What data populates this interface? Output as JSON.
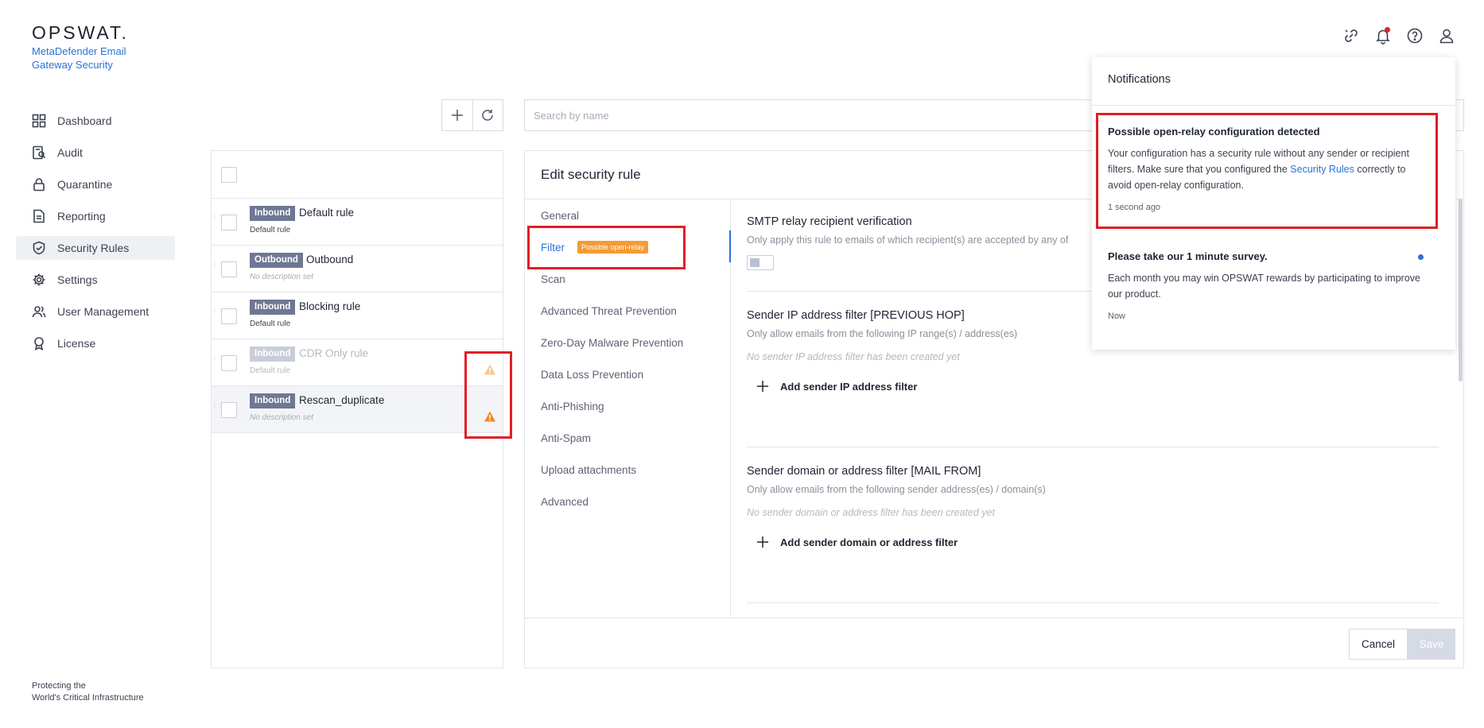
{
  "brand": {
    "logo": "OPSWAT.",
    "product": "MetaDefender Email Gateway Security",
    "tagline_line1": "Protecting the",
    "tagline_line2": "World's Critical Infrastructure"
  },
  "sidebar": {
    "items": [
      {
        "label": "Dashboard",
        "icon": "grid-icon"
      },
      {
        "label": "Audit",
        "icon": "audit-icon"
      },
      {
        "label": "Quarantine",
        "icon": "lock-icon"
      },
      {
        "label": "Reporting",
        "icon": "document-icon"
      },
      {
        "label": "Security Rules",
        "icon": "shield-check-icon",
        "active": true
      },
      {
        "label": "Settings",
        "icon": "gear-icon"
      },
      {
        "label": "User Management",
        "icon": "users-icon"
      },
      {
        "label": "License",
        "icon": "award-icon"
      }
    ]
  },
  "search": {
    "placeholder": "Search by name"
  },
  "rules": [
    {
      "direction": "Inbound",
      "name": "Default rule",
      "desc": "Default rule",
      "desc_italic": false,
      "warning": false,
      "disabled": false
    },
    {
      "direction": "Outbound",
      "name": "Outbound",
      "desc": "No description set",
      "desc_italic": true,
      "warning": false,
      "disabled": false
    },
    {
      "direction": "Inbound",
      "name": "Blocking rule",
      "desc": "Default rule",
      "desc_italic": false,
      "warning": false,
      "disabled": false
    },
    {
      "direction": "Inbound",
      "name": "CDR Only rule",
      "desc": "Default rule",
      "desc_italic": false,
      "warning": true,
      "disabled": true
    },
    {
      "direction": "Inbound",
      "name": "Rescan_duplicate",
      "desc": "No description set",
      "desc_italic": true,
      "warning": true,
      "disabled": false,
      "selected": true
    }
  ],
  "editor": {
    "title": "Edit security rule",
    "tabs": [
      {
        "label": "General"
      },
      {
        "label": "Filter",
        "badge": "Possible open-relay",
        "active": true
      },
      {
        "label": "Scan"
      },
      {
        "label": "Advanced Threat Prevention"
      },
      {
        "label": "Zero-Day Malware Prevention"
      },
      {
        "label": "Data Loss Prevention"
      },
      {
        "label": "Anti-Phishing"
      },
      {
        "label": "Anti-Spam"
      },
      {
        "label": "Upload attachments"
      },
      {
        "label": "Advanced"
      }
    ],
    "smtp": {
      "title": "SMTP relay recipient verification",
      "desc": "Only apply this rule to emails of which recipient(s) are accepted by any of",
      "enabled": false
    },
    "sender_ip": {
      "title": "Sender IP address filter [PREVIOUS HOP]",
      "desc": "Only allow emails from the following IP range(s) / address(es)",
      "empty": "No sender IP address filter has been created yet",
      "add_label": "Add sender IP address filter"
    },
    "sender_domain": {
      "title": "Sender domain or address filter [MAIL FROM]",
      "desc": "Only allow emails from the following sender address(es) / domain(s)",
      "empty": "No sender domain or address filter has been created yet",
      "add_label": "Add sender domain or address filter"
    },
    "cancel_label": "Cancel",
    "save_label": "Save"
  },
  "notifications": {
    "title": "Notifications",
    "items": [
      {
        "title": "Possible open-relay configuration detected",
        "body_before": "Your configuration has a security rule without any sender or recipient filters. Make sure that you configured the ",
        "link": "Security Rules",
        "body_after": " correctly to avoid open-relay configuration.",
        "time": "1 second ago"
      },
      {
        "title": "Please take our 1 minute survey.",
        "body": "Each month you may win OPSWAT rewards by participating to improve our product.",
        "time": "Now",
        "unread": true
      }
    ]
  },
  "colors": {
    "accent": "#2a72d6",
    "badge_orange": "#f49b36",
    "highlight_red": "#e01e26",
    "direction_badge": "#6e7894"
  }
}
